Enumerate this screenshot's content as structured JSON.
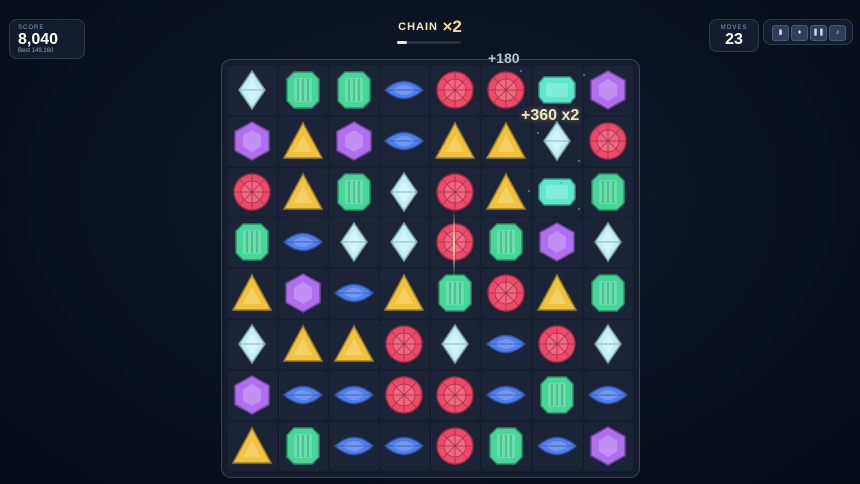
{
  "score": {
    "label": "SCORE",
    "value": "8,040",
    "best_label": "Best",
    "best_value": "149,160"
  },
  "moves": {
    "label": "MOVES",
    "value": "23"
  },
  "chain": {
    "label": "CHAIN",
    "multiplier": "×2",
    "progress": 0.15
  },
  "toolbar": {
    "icons": [
      "bar-chart-icon",
      "gem-icon",
      "pause-icon",
      "music-icon"
    ],
    "glyphs": [
      "▮",
      "♦",
      "❚❚",
      "♪"
    ]
  },
  "popups": {
    "first": "+180",
    "second": "+360 x2"
  },
  "gem_types": {
    "D": {
      "name": "diamond",
      "color": "#bfeef7"
    },
    "E": {
      "name": "emerald",
      "color": "#46d69a"
    },
    "M": {
      "name": "marquise",
      "color": "#4f7ff0"
    },
    "R": {
      "name": "ruby",
      "color": "#ef4a6a"
    },
    "H": {
      "name": "hexagon",
      "color": "#b06ef0"
    },
    "T": {
      "name": "triangle",
      "color": "#f2c23c"
    },
    "A": {
      "name": "aquamarine",
      "color": "#5de8cc"
    }
  },
  "board": [
    [
      "D",
      "E",
      "E",
      "M",
      "R",
      "R",
      "A",
      "H"
    ],
    [
      "H",
      "T",
      "H",
      "M",
      "T",
      "T",
      "D",
      "R"
    ],
    [
      "R",
      "T",
      "E",
      "D",
      "R",
      "T",
      "A",
      "E"
    ],
    [
      "E",
      "M",
      "D",
      "D",
      "R",
      "E",
      "H",
      "D"
    ],
    [
      "T",
      "H",
      "M",
      "T",
      "E",
      "R",
      "T",
      "E"
    ],
    [
      "D",
      "T",
      "T",
      "R",
      "D",
      "M",
      "R",
      "D"
    ],
    [
      "H",
      "M",
      "M",
      "R",
      "R",
      "M",
      "E",
      "M"
    ],
    [
      "T",
      "E",
      "M",
      "M",
      "R",
      "E",
      "M",
      "H"
    ]
  ]
}
